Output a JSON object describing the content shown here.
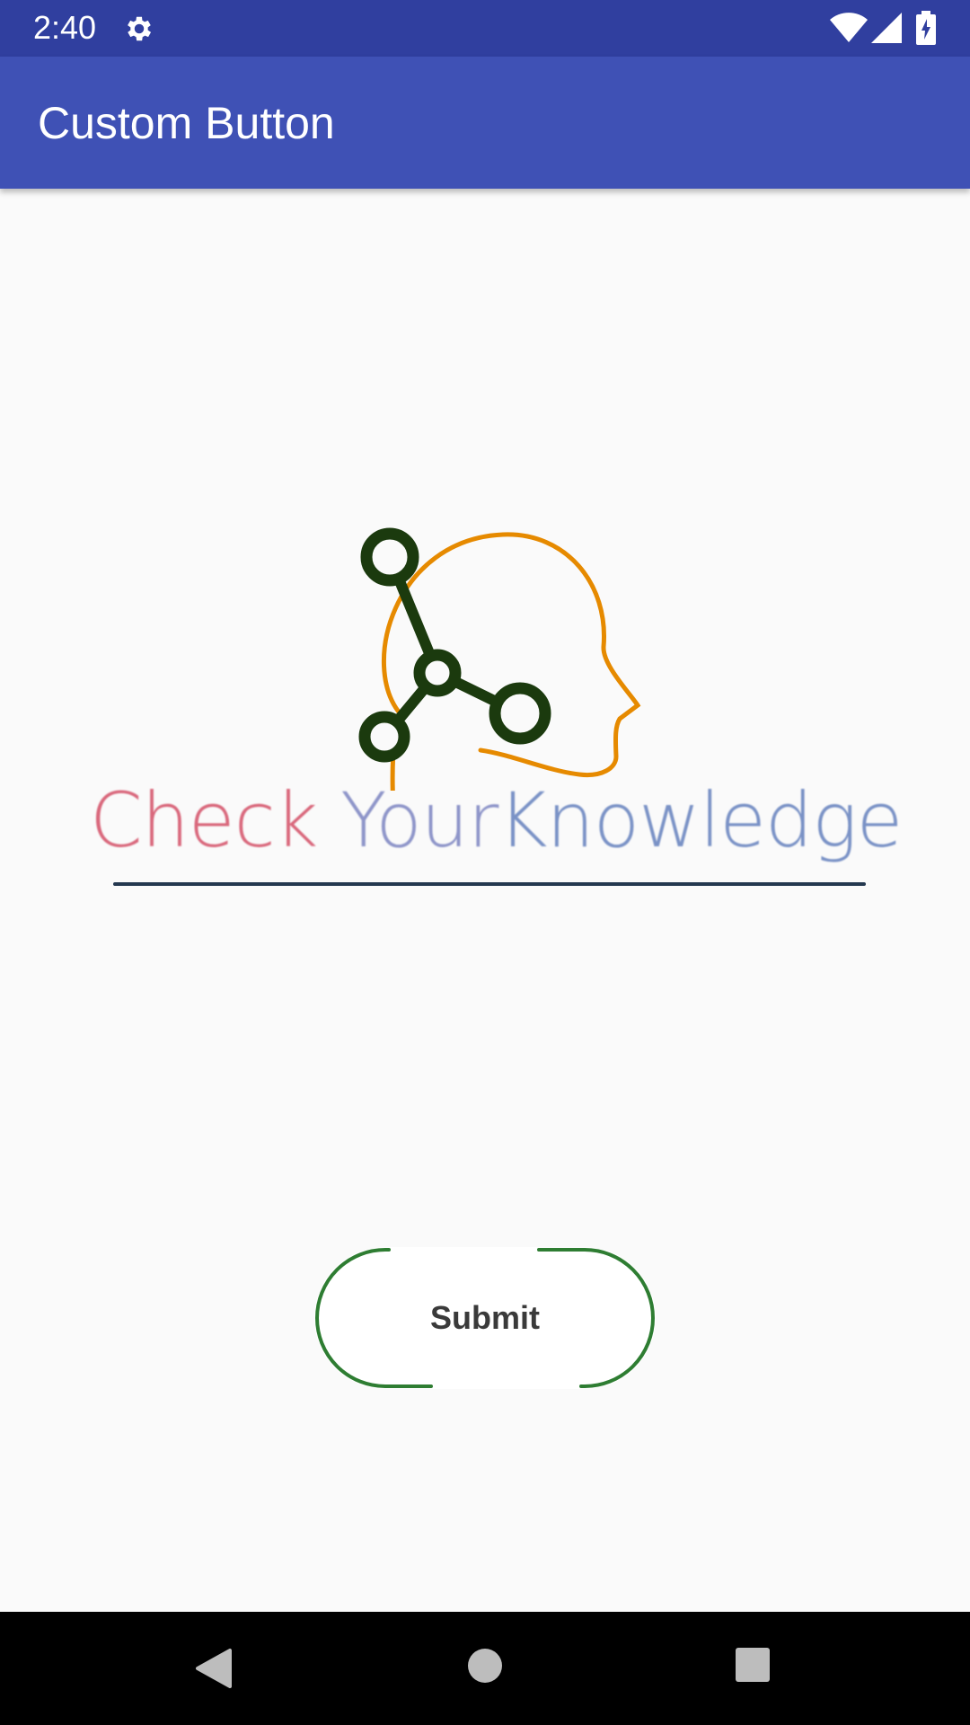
{
  "status_bar": {
    "time": "2:40",
    "icons": [
      "gear-icon",
      "wifi-icon",
      "signal-icon",
      "battery-charging-icon"
    ],
    "background": "#303f9f"
  },
  "app_bar": {
    "title": "Custom Button",
    "background": "#3f51b5"
  },
  "logo": {
    "text_check": "Check",
    "text_your": "Your",
    "text_knowledge": "Knowledge",
    "colors": {
      "check": "#d9687c",
      "your": "#8e95c9",
      "knowledge": "#7a92c6",
      "head_outline": "#e68a00",
      "molecule": "#1b3a0e",
      "underline": "#24384f"
    }
  },
  "submit_button": {
    "label": "Submit",
    "outline_color": "#2e7d32"
  },
  "nav_bar": {
    "icons": [
      "back-icon",
      "home-icon",
      "recents-icon"
    ]
  }
}
